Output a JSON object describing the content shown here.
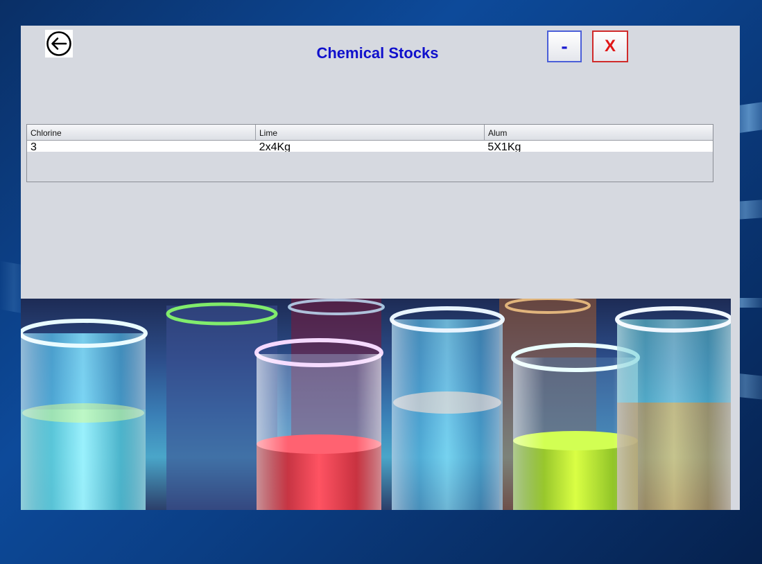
{
  "window": {
    "title": "Chemical Stocks",
    "minimize_label": "-",
    "close_label": "X"
  },
  "table": {
    "columns": [
      "Chlorine",
      "Lime",
      "Alum"
    ],
    "rows": [
      [
        "3",
        "2x4Kg",
        "5X1Kg"
      ]
    ]
  },
  "icons": {
    "back": "back-arrow-icon"
  },
  "colors": {
    "title": "#1010cc",
    "close": "#e01818",
    "minimize": "#1a1ad0",
    "window_bg": "#d6d9e0"
  }
}
